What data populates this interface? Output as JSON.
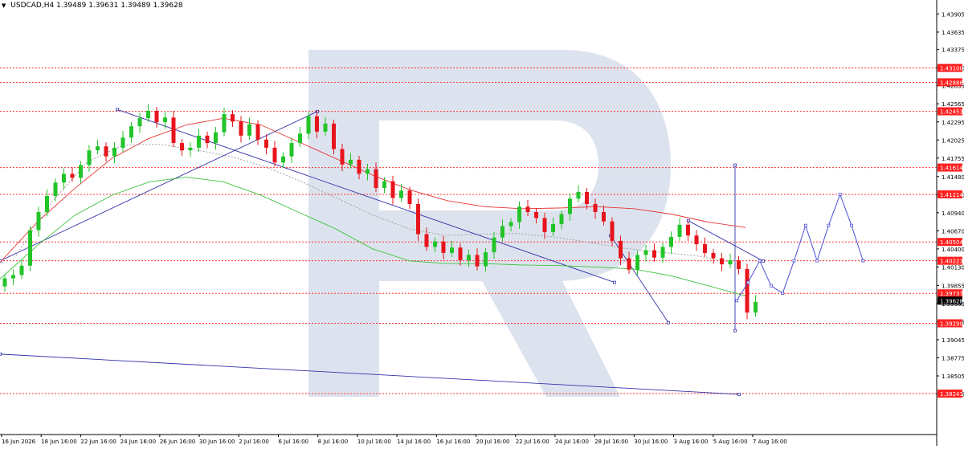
{
  "header": {
    "symbol": "USDCAD,H4",
    "ohlc": "1.39489 1.39631 1.39489 1.39628"
  },
  "colors": {
    "bull": "#22c42a",
    "bear": "#e8141c",
    "level_line": "#ff3030",
    "level_badge": "#ff2020",
    "current_badge": "#000000",
    "ma_slow": "#e53535",
    "ma_mid": "#3cc43c",
    "ma_fast": "#9a9a9a",
    "trendline": "#3333aa",
    "forecast": "#4f4fd6",
    "watermark": "#dde3ee"
  },
  "chart_data": {
    "type": "candlestick",
    "instrument": "USDCAD",
    "timeframe": "H4",
    "ylim": [
      1.3763,
      1.4397
    ],
    "y_ticks": [
      1.43905,
      1.43635,
      1.43375,
      1.431,
      1.42835,
      1.42565,
      1.42295,
      1.42025,
      1.41755,
      1.4148,
      1.4121,
      1.4094,
      1.4067,
      1.404,
      1.4013,
      1.39855,
      1.39585,
      1.39315,
      1.39045,
      1.38775,
      1.38505,
      1.38235
    ],
    "x_ticks": [
      "16 Jun 2026",
      "18 Jun 16:00",
      "22 Jun 16:00",
      "24 Jun 16:00",
      "26 Jun 16:00",
      "30 Jun 16:00",
      "2 Jul 16:00",
      "6 Jul 16:00",
      "8 Jul 16:00",
      "10 Jul 16:00",
      "14 Jul 16:00",
      "16 Jul 16:00",
      "20 Jul 16:00",
      "22 Jul 16:00",
      "24 Jul 16:00",
      "28 Jul 16:00",
      "30 Jul 16:00",
      "3 Aug 16:00",
      "5 Aug 16:00",
      "7 Aug 16:00"
    ],
    "levels": [
      1.431,
      1.42886,
      1.42453,
      1.41614,
      1.41214,
      1.40504,
      1.40223,
      1.39737,
      1.3929,
      1.38241
    ],
    "current_price": 1.39628,
    "closes": [
      1.3996,
      1.4001,
      1.4015,
      1.4068,
      1.4095,
      1.4119,
      1.4139,
      1.4152,
      1.4146,
      1.4165,
      1.4187,
      1.4193,
      1.4178,
      1.4191,
      1.4206,
      1.4223,
      1.4235,
      1.4246,
      1.4229,
      1.4236,
      1.4198,
      1.4187,
      1.4191,
      1.4209,
      1.4198,
      1.4214,
      1.4241,
      1.423,
      1.4209,
      1.4226,
      1.4203,
      1.4191,
      1.4169,
      1.4178,
      1.4198,
      1.4212,
      1.4238,
      1.4215,
      1.4227,
      1.4189,
      1.4166,
      1.4173,
      1.4152,
      1.4159,
      1.4131,
      1.4141,
      1.4116,
      1.4127,
      1.4107,
      1.4062,
      1.4043,
      1.4051,
      1.4034,
      1.4042,
      1.4023,
      1.4031,
      1.4014,
      1.4035,
      1.4057,
      1.4074,
      1.408,
      1.4103,
      1.4095,
      1.4086,
      1.4065,
      1.4077,
      1.4092,
      1.4115,
      1.4125,
      1.4107,
      1.4095,
      1.4081,
      1.4052,
      1.4026,
      1.4009,
      1.4031,
      1.4038,
      1.4027,
      1.4043,
      1.4058,
      1.4076,
      1.406,
      1.4047,
      1.4034,
      1.4026,
      1.4017,
      1.4023,
      1.401,
      1.3945,
      1.3961
    ],
    "moving_averages": [
      {
        "values": [
          1.402,
          1.408,
          1.413,
          1.4175,
          1.4205,
          1.4225,
          1.4235,
          1.4225,
          1.42,
          1.4175,
          1.415,
          1.4128,
          1.4112,
          1.4103,
          1.41,
          1.4101,
          1.4103,
          1.41,
          1.4092,
          1.408,
          1.4072
        ]
      },
      {
        "values": [
          1.3995,
          1.4045,
          1.409,
          1.412,
          1.414,
          1.4147,
          1.414,
          1.412,
          1.4095,
          1.407,
          1.404,
          1.4022,
          1.4018,
          1.4018,
          1.4016,
          1.4015,
          1.4013,
          1.401,
          1.4,
          1.3985,
          1.397
        ]
      },
      {
        "values": [
          1.403,
          1.411,
          1.417,
          1.4195,
          1.4196,
          1.4188,
          1.4178,
          1.4162,
          1.414,
          1.4115,
          1.409,
          1.407,
          1.406,
          1.4062,
          1.4063,
          1.4058,
          1.405,
          1.4041,
          1.4035,
          1.403,
          1.402
        ]
      }
    ],
    "forecast_path": [
      1.39628,
      1.399,
      1.40223,
      1.3985,
      1.39737,
      1.40223,
      1.4075,
      1.40223,
      1.4075,
      1.41214,
      1.4075,
      1.40223
    ]
  }
}
